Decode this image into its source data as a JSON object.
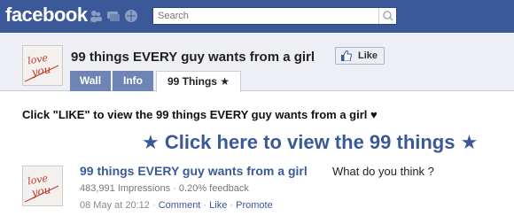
{
  "topbar": {
    "logo": "facebook",
    "search_placeholder": "Search",
    "icons": [
      "friends-icon",
      "messages-icon",
      "notifications-icon"
    ],
    "colors": {
      "brand": "#3b5998",
      "link": "#3b5998",
      "tab": "#6d84b4"
    }
  },
  "page": {
    "title": "99 things EVERY guy wants from a girl",
    "like_label": "Like",
    "thumb_text": "love you"
  },
  "tabs": [
    {
      "label": "Wall"
    },
    {
      "label": "Info"
    },
    {
      "label": "99 Things ★"
    }
  ],
  "content": {
    "instruction": "Click \"LIKE\" to view the 99 things EVERY guy wants from a girl ♥",
    "big_cta": "★ Click here to view the 99 things ★"
  },
  "post": {
    "title": "99 things EVERY guy wants from a girl",
    "question": "What do you think ?",
    "impressions": "483,991 Impressions",
    "feedback": "0.20% feedback",
    "date": "08 May at 20:12",
    "comment": "Comment",
    "like": "Like",
    "promote": "Promote"
  }
}
